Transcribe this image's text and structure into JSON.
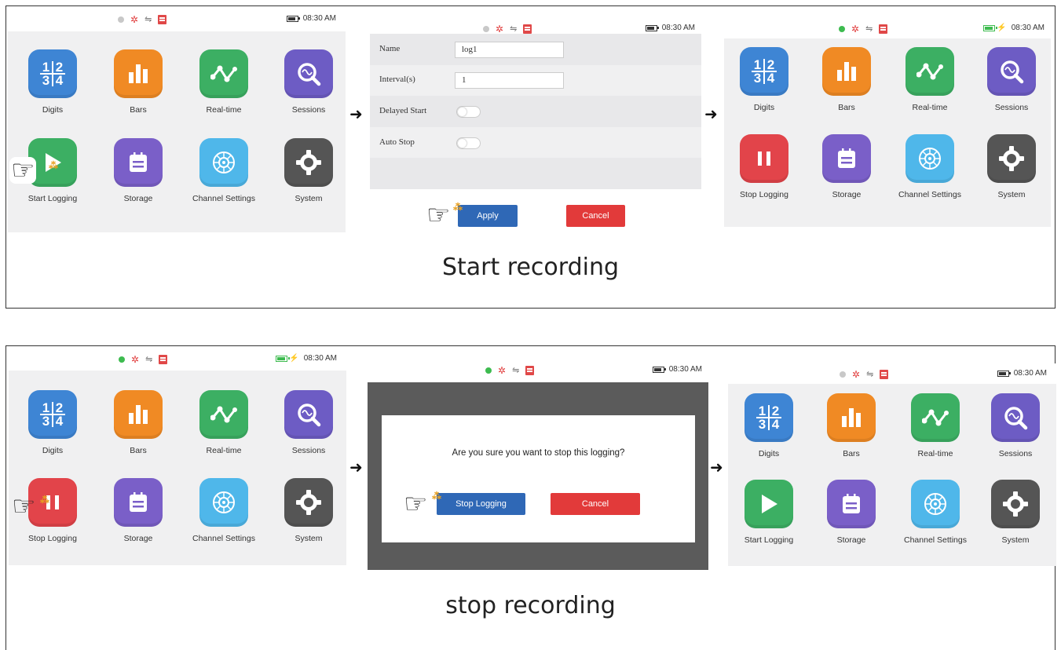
{
  "status": {
    "time": "08:30 AM"
  },
  "apps": {
    "digits": "Digits",
    "bars": "Bars",
    "realtime": "Real-time",
    "sessions": "Sessions",
    "start_logging": "Start Logging",
    "stop_logging": "Stop Logging",
    "storage": "Storage",
    "channel_settings": "Channel Settings",
    "system": "System"
  },
  "form": {
    "name_label": "Name",
    "name_value": "log1",
    "interval_label": "Interval(s)",
    "interval_value": "1",
    "delayed_label": "Delayed Start",
    "autostop_label": "Auto Stop",
    "apply": "Apply",
    "cancel": "Cancel"
  },
  "dialog": {
    "message": "Are you sure you want to stop this logging?",
    "stop": "Stop Logging",
    "cancel": "Cancel"
  },
  "captions": {
    "start": "Start recording",
    "stop": "stop recording"
  },
  "icons": {
    "digits": "fraction-grid-icon",
    "bars": "bar-chart-icon",
    "realtime": "line-graph-icon",
    "sessions": "magnifier-wave-icon",
    "start": "play-icon",
    "stop": "pause-icon",
    "storage": "clipboard-icon",
    "channel": "network-gear-icon",
    "system": "gear-icon",
    "pointer": "pointing-hand-icon"
  },
  "colors": {
    "blue_button": "#2f68b6",
    "red_button": "#e23a3a",
    "green_status": "#3dbb4f"
  }
}
